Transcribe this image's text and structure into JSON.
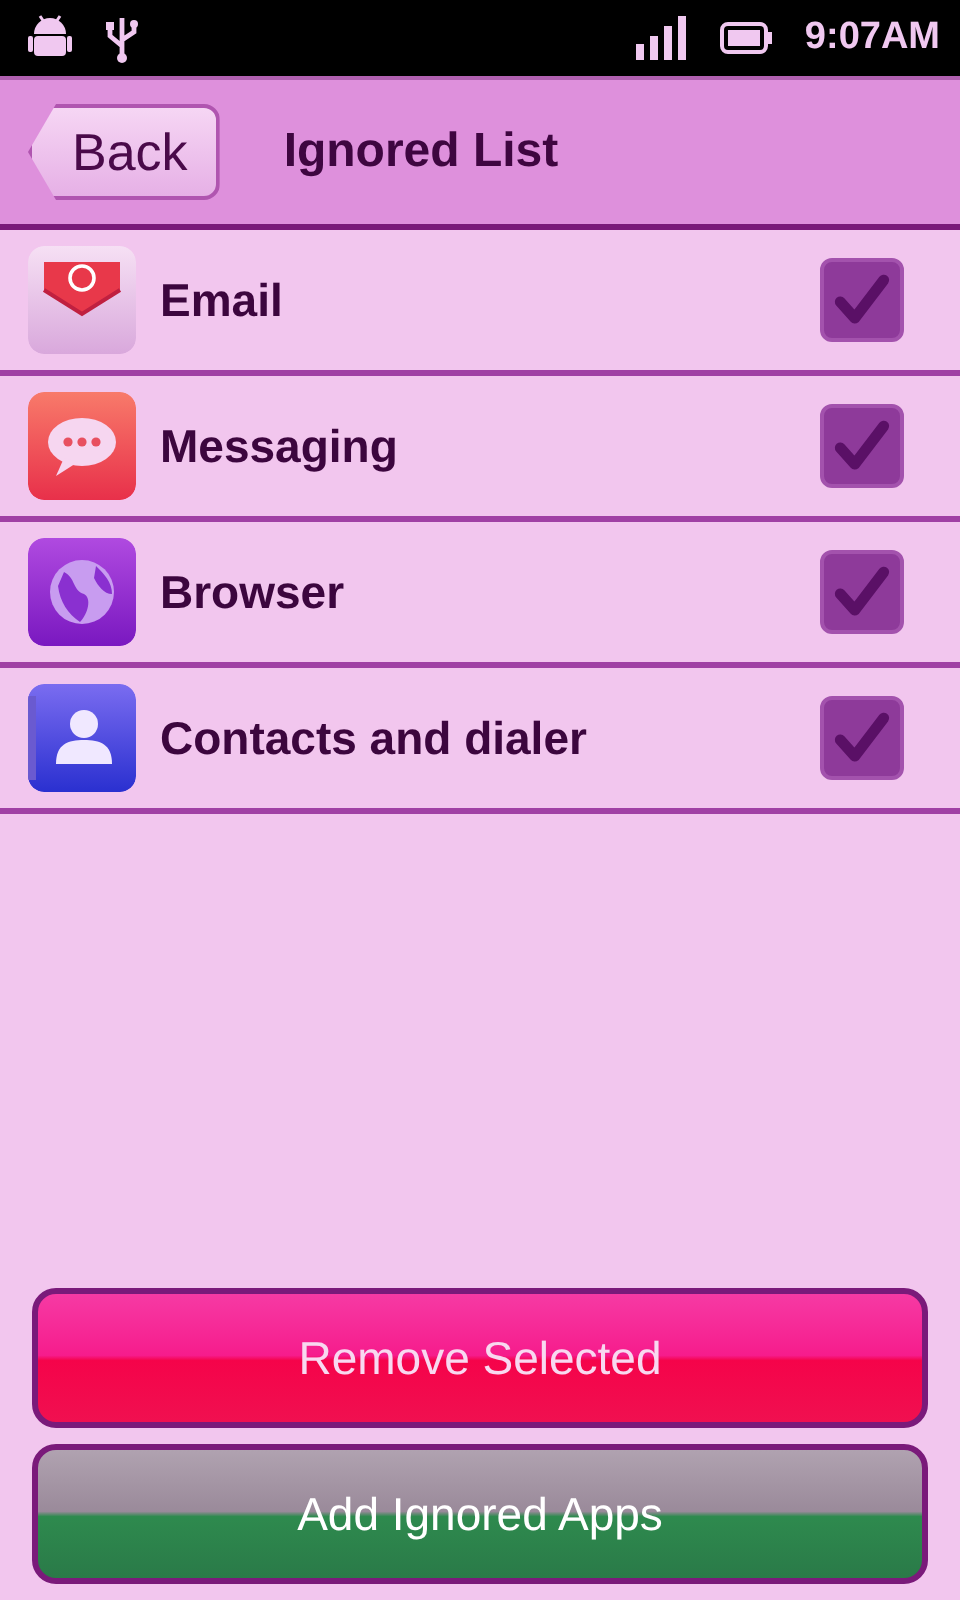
{
  "status_bar": {
    "time": "9:07AM"
  },
  "header": {
    "back_label": "Back",
    "title": "Ignored List"
  },
  "apps": [
    {
      "kind": "email",
      "name": "Email",
      "checked": true
    },
    {
      "kind": "messaging",
      "name": "Messaging",
      "checked": true
    },
    {
      "kind": "browser",
      "name": "Browser",
      "checked": true
    },
    {
      "kind": "contacts",
      "name": "Contacts and dialer",
      "checked": true
    }
  ],
  "buttons": [
    {
      "kind": "remove",
      "label": "Remove Selected"
    },
    {
      "kind": "add",
      "label": "Add Ignored Apps"
    }
  ]
}
